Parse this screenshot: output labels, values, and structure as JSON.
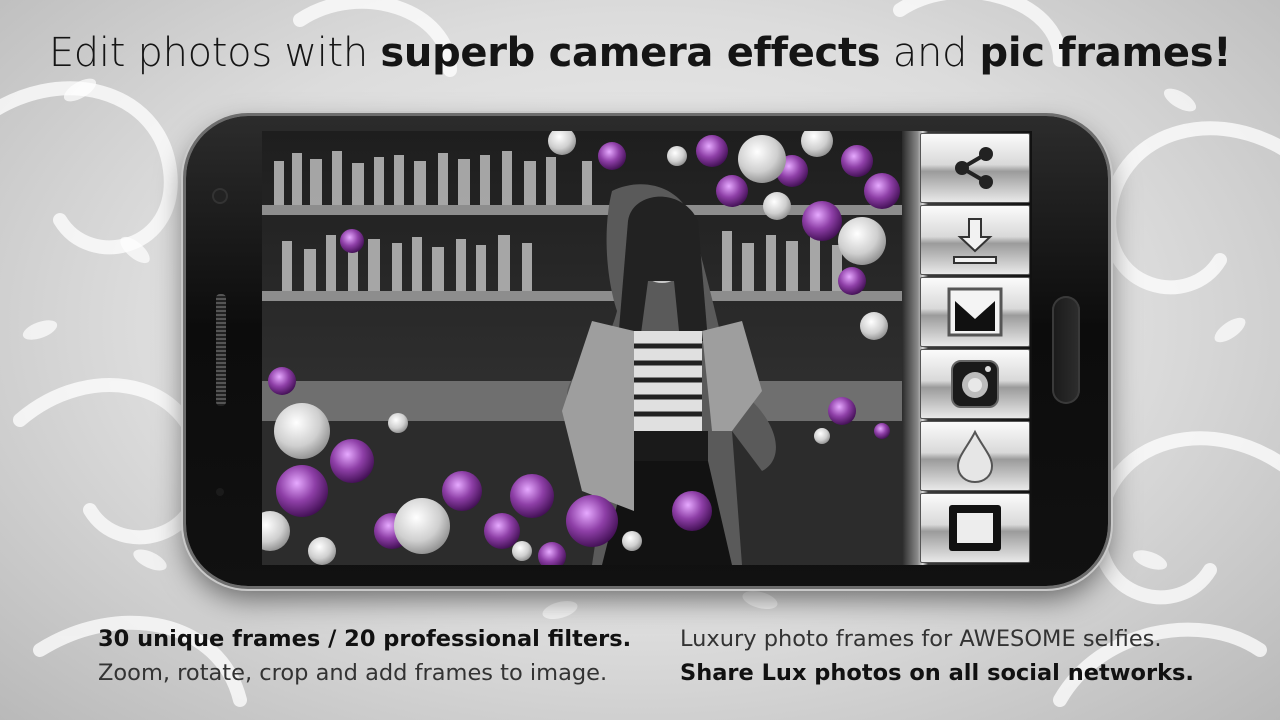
{
  "headline": {
    "part1": "Edit photos with ",
    "part2": "superb camera effects",
    "part3": " and ",
    "part4": "pic frames!"
  },
  "toolbar": {
    "buttons": [
      {
        "icon": "share-icon"
      },
      {
        "icon": "download-icon"
      },
      {
        "icon": "mask-icon"
      },
      {
        "icon": "camera-effect-icon"
      },
      {
        "icon": "drop-icon"
      },
      {
        "icon": "frame-icon"
      }
    ]
  },
  "captions": {
    "left_line1": "30 unique frames / 20 professional filters.",
    "left_line2": "Zoom, rotate, crop and add frames to image.",
    "right_line1": "Luxury photo frames for AWESOME selfies.",
    "right_line2": "Share Lux photos on all social networks."
  },
  "colors": {
    "gem_purple": "#8e3fa7",
    "phone_body": "#111111",
    "background": "#d9d9d9"
  }
}
